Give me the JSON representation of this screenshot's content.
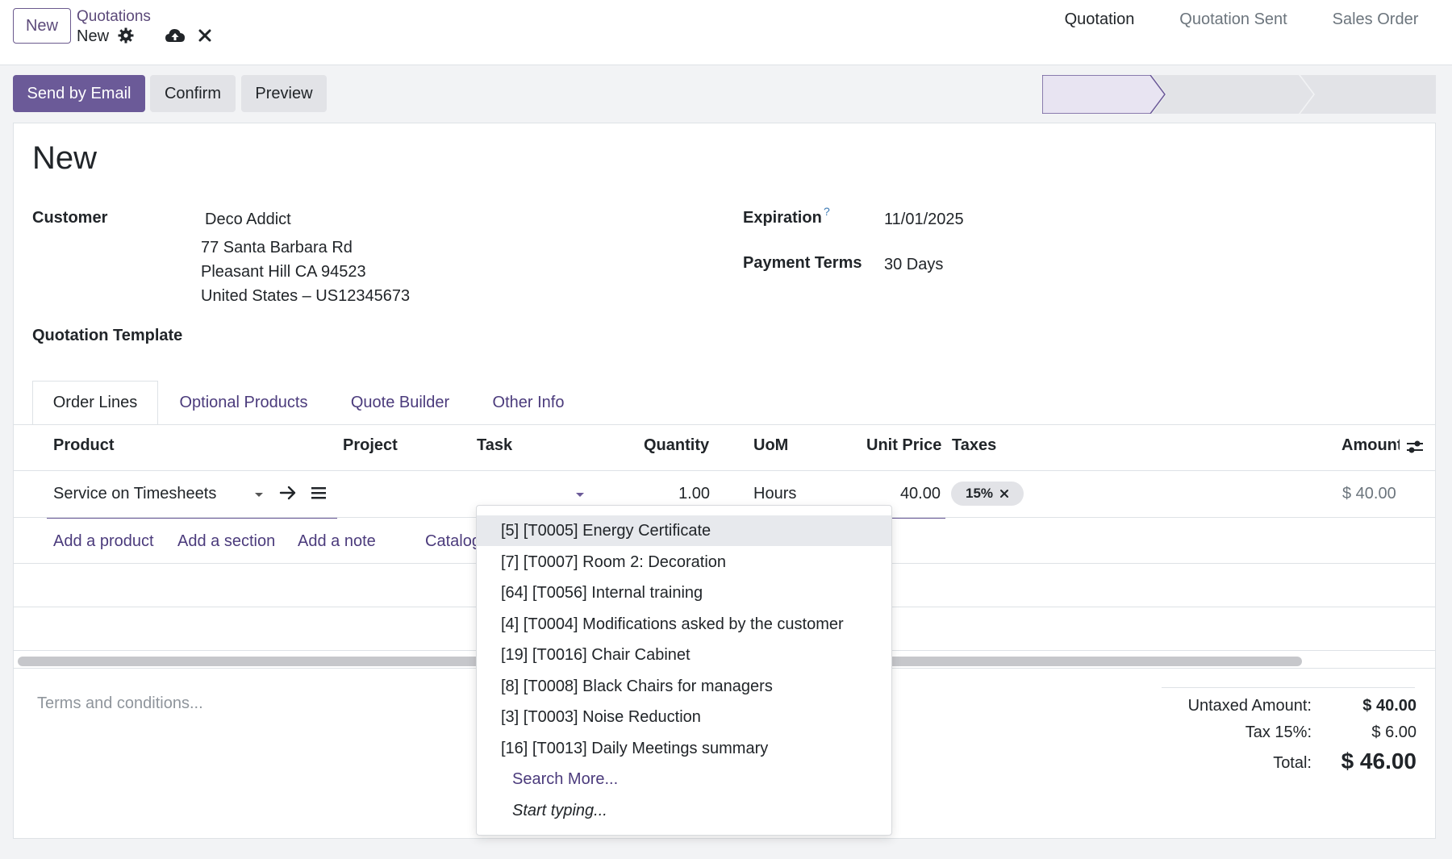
{
  "topbar": {
    "new_button": "New",
    "breadcrumb_parent": "Quotations",
    "breadcrumb_current": "New"
  },
  "actions": {
    "send_email": "Send by Email",
    "confirm": "Confirm",
    "preview": "Preview"
  },
  "status": {
    "steps": [
      "Quotation",
      "Quotation Sent",
      "Sales Order"
    ],
    "active": "Quotation"
  },
  "form": {
    "title": "New",
    "customer_label": "Customer",
    "customer_name": "Deco Addict",
    "address_line1": "77 Santa Barbara Rd",
    "address_line2": "Pleasant Hill CA 94523",
    "address_line3": "United States – US12345673",
    "template_label": "Quotation Template",
    "expiration_label": "Expiration",
    "expiration_help": "?",
    "expiration_value": "11/01/2025",
    "payment_terms_label": "Payment Terms",
    "payment_terms_value": "30 Days"
  },
  "tabs": [
    "Order Lines",
    "Optional Products",
    "Quote Builder",
    "Other Info"
  ],
  "table": {
    "headers": {
      "product": "Product",
      "project": "Project",
      "task": "Task",
      "quantity": "Quantity",
      "uom": "UoM",
      "unit_price": "Unit Price",
      "taxes": "Taxes",
      "amount": "Amount"
    },
    "row": {
      "product": "Service on Timesheets",
      "quantity": "1.00",
      "uom": "Hours",
      "unit_price": "40.00",
      "tax": "15%",
      "amount": "$ 40.00"
    },
    "add_links": {
      "product": "Add a product",
      "section": "Add a section",
      "note": "Add a note",
      "catalog": "Catalog"
    }
  },
  "task_dropdown": {
    "items": [
      "[5] [T0005] Energy Certificate",
      "[7] [T0007] Room 2: Decoration",
      "[64] [T0056] Internal training",
      "[4] [T0004] Modifications asked by the customer",
      "[19] [T0016] Chair Cabinet",
      "[8] [T0008] Black Chairs for managers",
      "[3] [T0003] Noise Reduction",
      "[16] [T0013] Daily Meetings summary"
    ],
    "search_more": "Search More...",
    "start_typing": "Start typing..."
  },
  "footer": {
    "terms_placeholder": "Terms and conditions...",
    "untaxed_label": "Untaxed Amount:",
    "untaxed_value": "$ 40.00",
    "tax_label": "Tax 15%:",
    "tax_value": "$ 6.00",
    "total_label": "Total:",
    "total_value": "$ 46.00"
  },
  "colors": {
    "primary": "#6b5a98",
    "link": "#4b3b7c",
    "status_active_bg": "#e8e4f2"
  }
}
